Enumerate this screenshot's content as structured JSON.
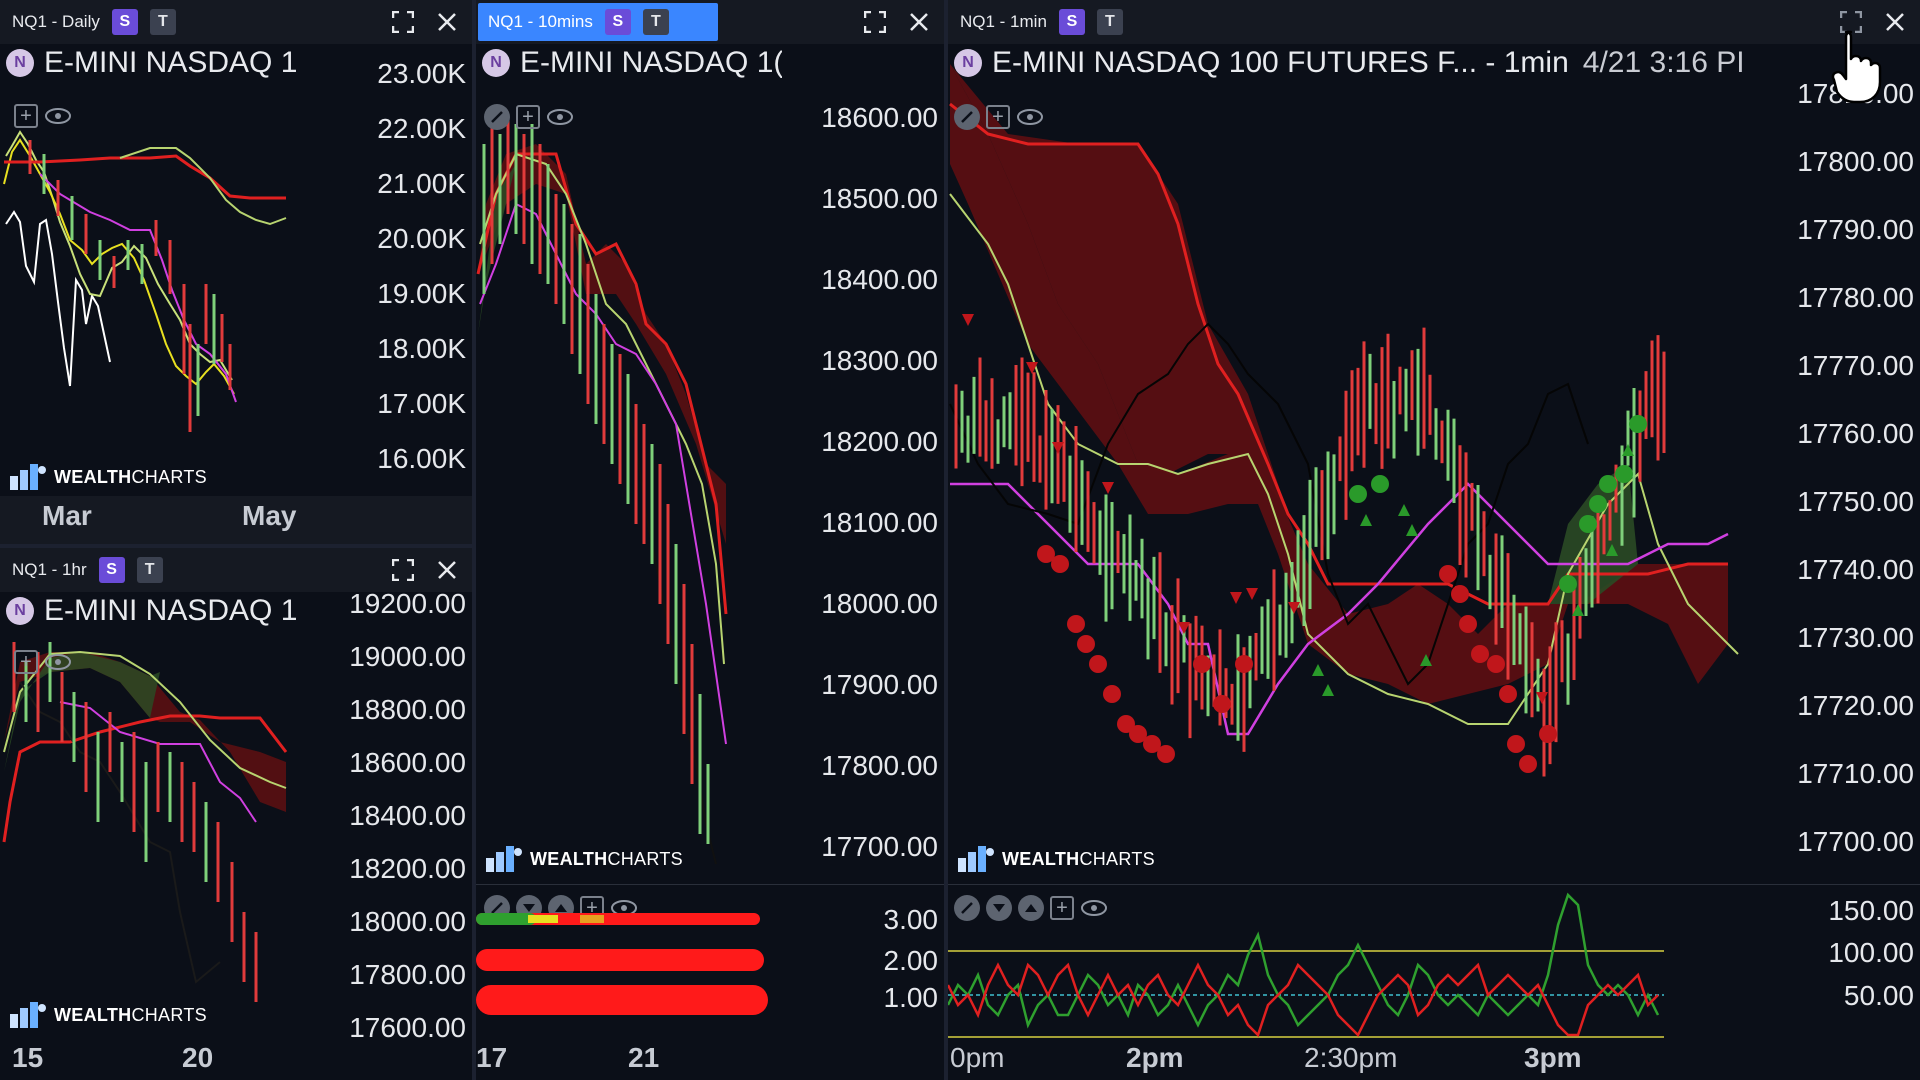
{
  "panels": {
    "daily": {
      "tab": "NQ1 - Daily",
      "s": "S",
      "t": "T",
      "symbol": "E-MINI NASDAQ 1",
      "yticks": [
        "23.00K",
        "22.00K",
        "21.00K",
        "20.00K",
        "19.00K",
        "18.00K",
        "17.00K",
        "16.00K"
      ],
      "xticks": [
        "Mar",
        "May"
      ]
    },
    "hourly": {
      "tab": "NQ1 - 1hr",
      "s": "S",
      "t": "T",
      "symbol": "E-MINI NASDAQ 1",
      "yticks": [
        "19200.00",
        "19000.00",
        "18800.00",
        "18600.00",
        "18400.00",
        "18200.00",
        "18000.00",
        "17800.00",
        "17600.00"
      ],
      "xticks": [
        "15",
        "20"
      ]
    },
    "tenmin": {
      "tab": "NQ1 - 10mins",
      "s": "S",
      "t": "T",
      "symbol": "E-MINI NASDAQ 1(",
      "yticks": [
        "18600.00",
        "18500.00",
        "18400.00",
        "18300.00",
        "18200.00",
        "18100.00",
        "18000.00",
        "17900.00",
        "17800.00",
        "17700.00"
      ],
      "subticks": [
        "3.00",
        "2.00",
        "1.00"
      ],
      "xticks": [
        "17",
        "21"
      ]
    },
    "onemin": {
      "tab": "NQ1 - 1min",
      "s": "S",
      "t": "T",
      "symbol": "E-MINI NASDAQ 100 FUTURES F... - 1min",
      "time": "4/21 3:16 PI",
      "yticks": [
        "17810.00",
        "17800.00",
        "17790.00",
        "17780.00",
        "17770.00",
        "17760.00",
        "17750.00",
        "17740.00",
        "17730.00",
        "17720.00",
        "17710.00",
        "17700.00"
      ],
      "subticks": [
        "150.00",
        "100.00",
        "50.00"
      ],
      "xticks": [
        "0pm",
        "2pm",
        "2:30pm",
        "3pm"
      ]
    }
  },
  "symbol_badge": "N",
  "watermark": {
    "bold": "WEALTH",
    "rest": "CHARTS"
  },
  "colors": {
    "bull": "#7fd07a",
    "bear": "#e23b3b",
    "cloud_bear": "#5a0f12",
    "cloud_bull": "#2a4a25",
    "kijun": "#e02020",
    "tenkan": "#d040e0",
    "lagging": "#c8e07a",
    "accent": "#3a86ff"
  }
}
